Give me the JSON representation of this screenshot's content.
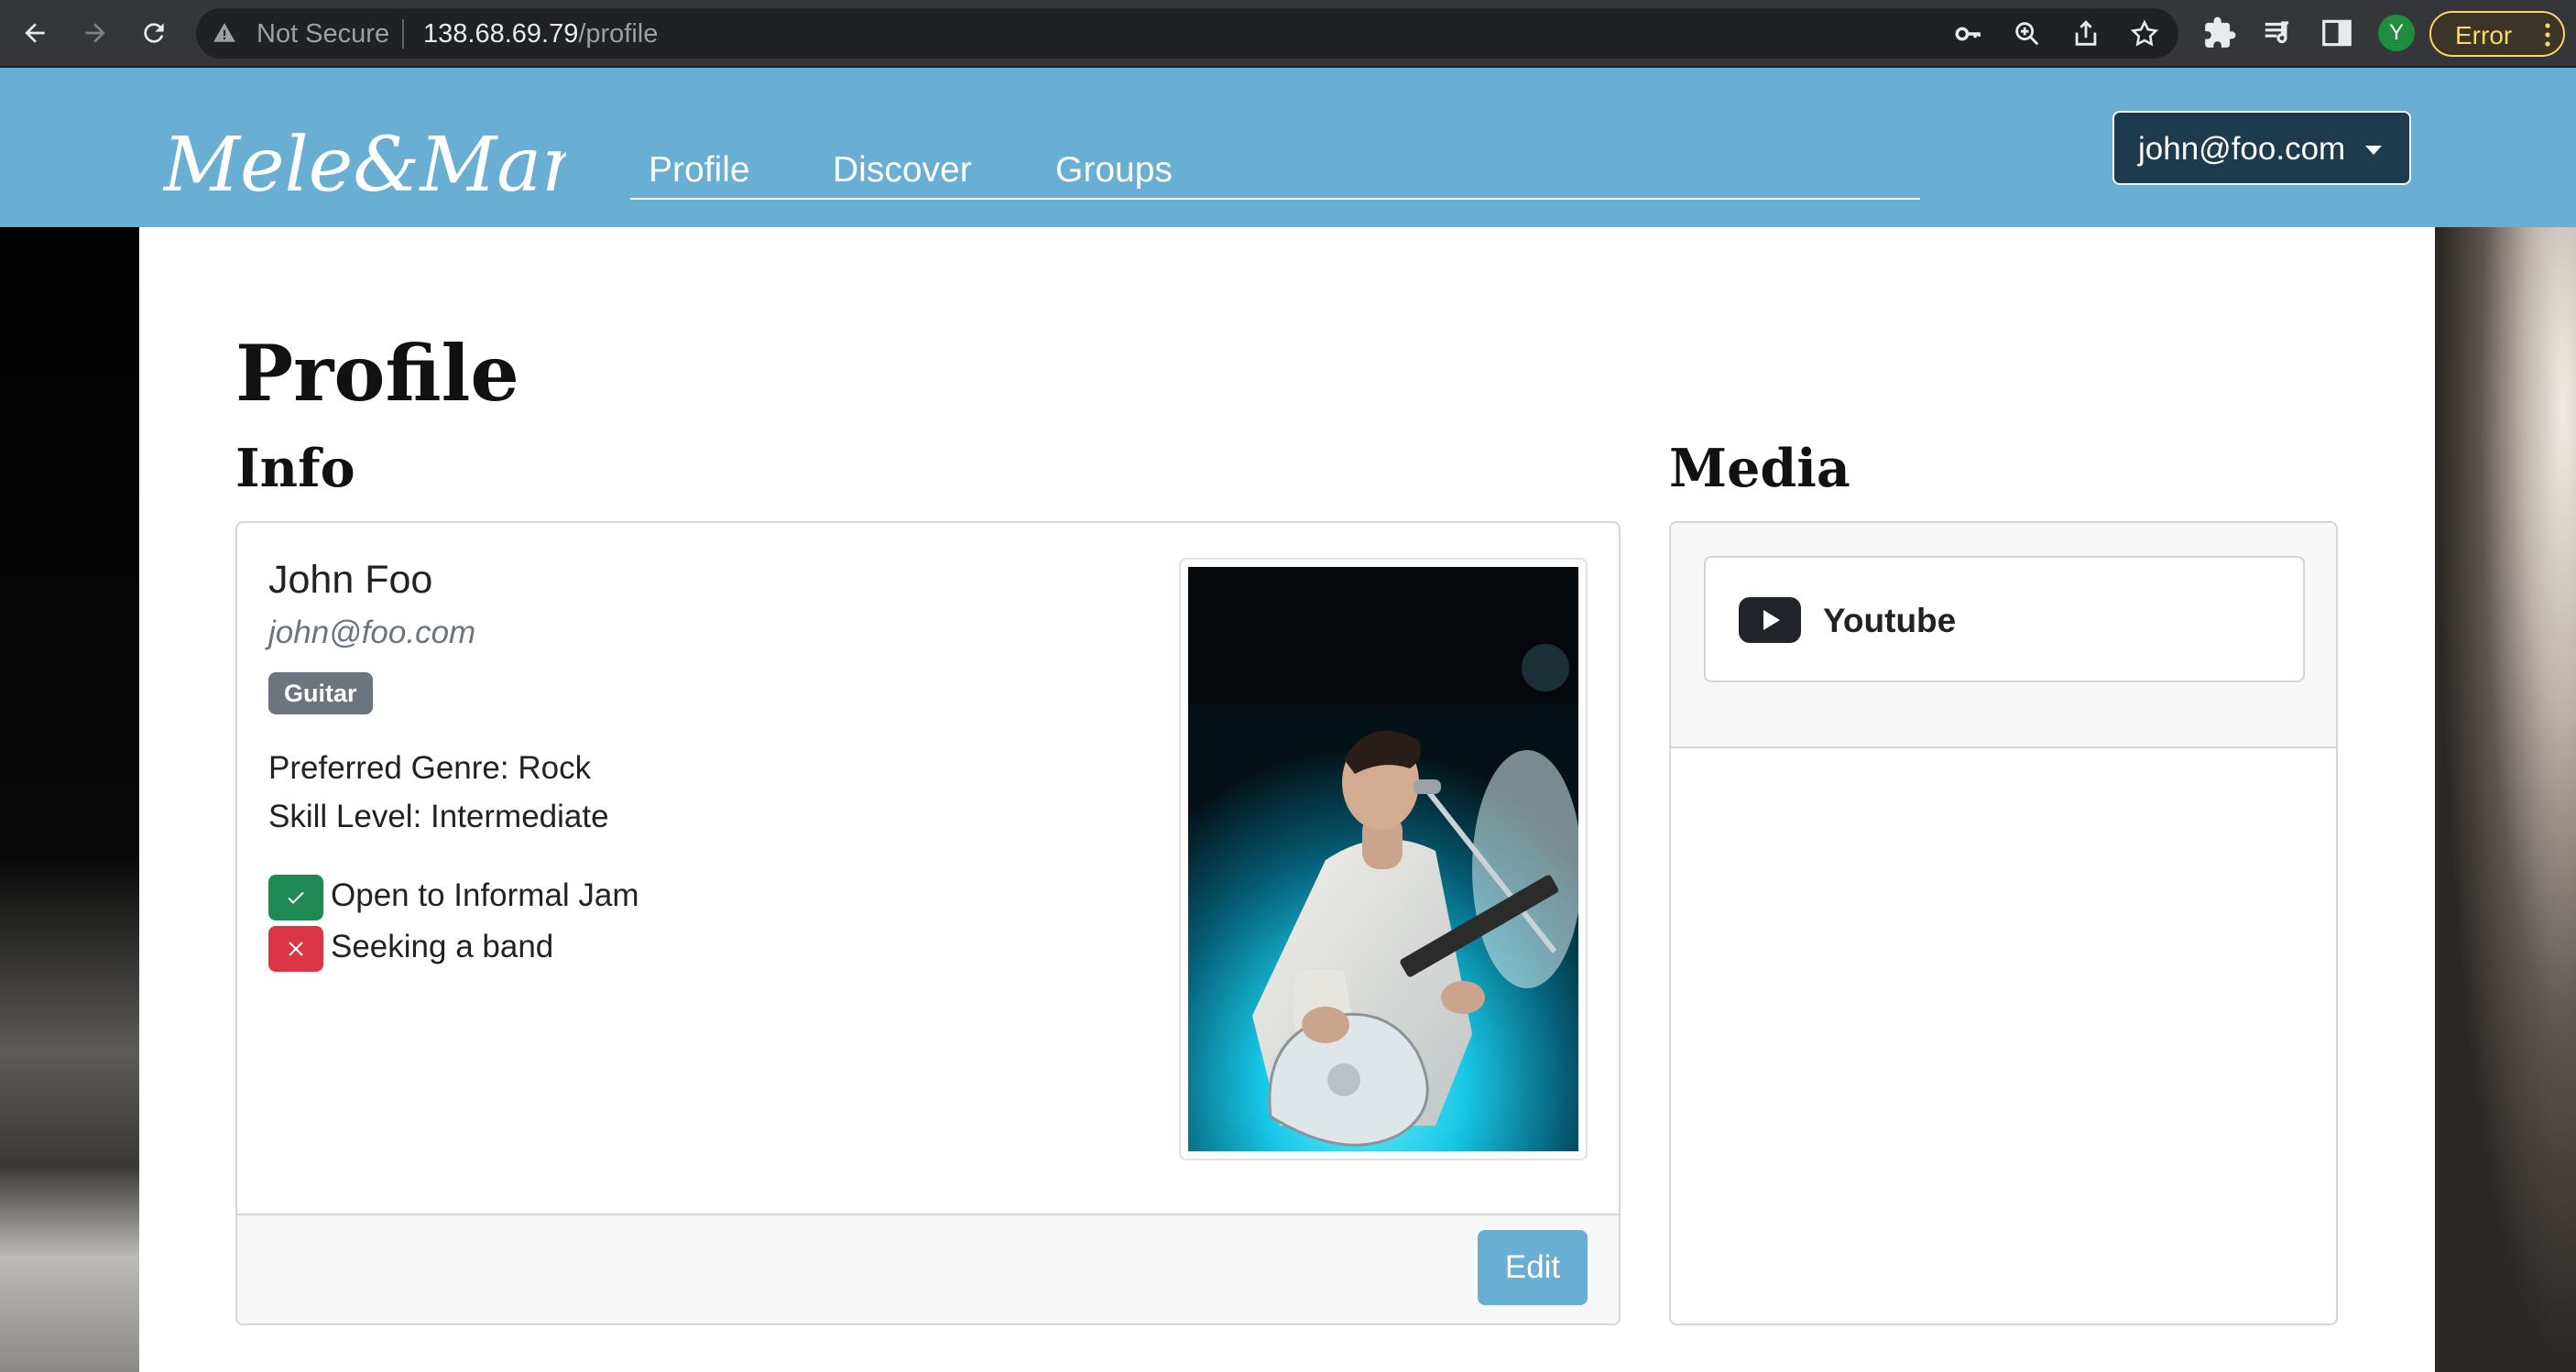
{
  "browser": {
    "security_label": "Not Secure",
    "url_host": "138.68.69.79",
    "url_path": "/profile",
    "profile_initial": "Y",
    "error_label": "Error"
  },
  "site": {
    "logo_text": "Mele&Manoa",
    "nav": [
      "Profile",
      "Discover",
      "Groups"
    ],
    "user_menu_label": "john@foo.com"
  },
  "page": {
    "title": "Profile"
  },
  "info": {
    "section_title": "Info",
    "name": "John Foo",
    "email": "john@foo.com",
    "instrument_badge": "Guitar",
    "preferred_genre": "Preferred Genre: Rock",
    "skill_level": "Skill Level: Intermediate",
    "flags": [
      {
        "label": "Open to Informal Jam",
        "value": true
      },
      {
        "label": "Seeking a band",
        "value": false
      }
    ],
    "edit_label": "Edit"
  },
  "media": {
    "section_title": "Media",
    "items": [
      {
        "label": "Youtube",
        "icon": "youtube-icon"
      }
    ]
  },
  "colors": {
    "navbar": "#69aed3",
    "user_button": "#1e3a4d",
    "badge": "#6c757d",
    "success": "#1f8a54",
    "danger": "#dc3545"
  }
}
